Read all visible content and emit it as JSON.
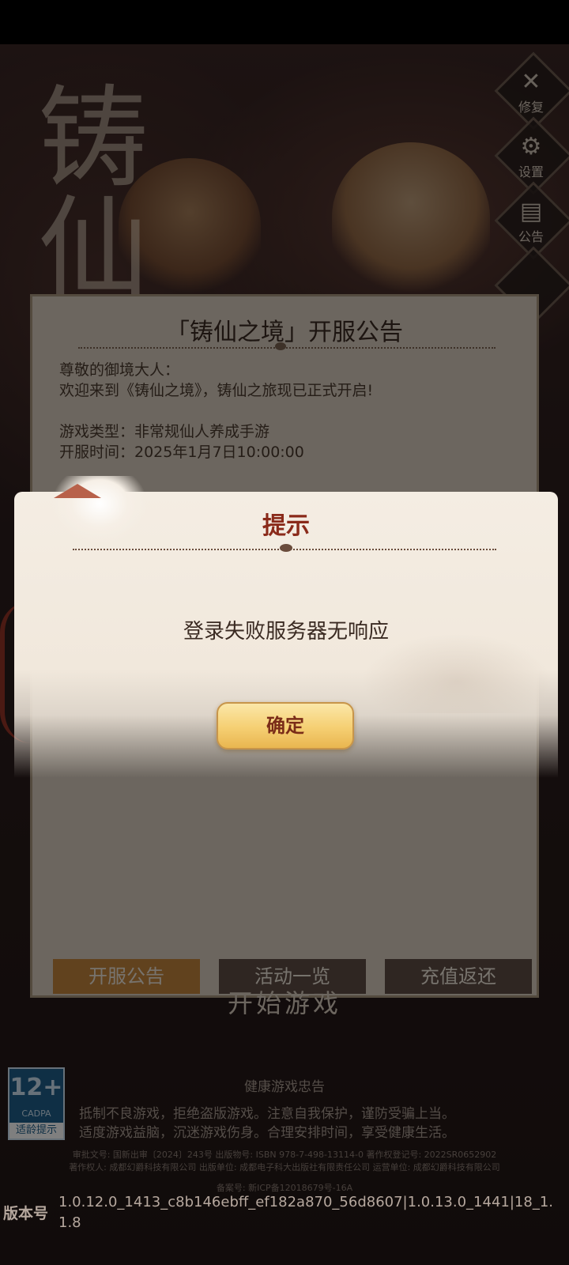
{
  "background": {
    "logo_text": "铸仙"
  },
  "side_menu": {
    "items": [
      {
        "label": "修复",
        "icon": "wrench-icon",
        "glyph": "✕"
      },
      {
        "label": "设置",
        "icon": "gear-icon",
        "glyph": "⚙"
      },
      {
        "label": "公告",
        "icon": "notice-board-icon",
        "glyph": "▤"
      }
    ]
  },
  "notice": {
    "title": "「铸仙之境」开服公告",
    "lines": [
      "尊敬的御境大人：",
      "欢迎来到《铸仙之境》，铸仙之旅现已正式开启!",
      "游戏类型：非常规仙人养成手游",
      "开服时间：2025年1月7日10:00:00"
    ],
    "tabs": [
      "开服公告",
      "活动一览",
      "充值返还"
    ],
    "active_tab": 0
  },
  "start_game_label": "开始游戏",
  "dialog": {
    "title": "提示",
    "message": "登录失败服务器无响应",
    "confirm_label": "确定"
  },
  "footer": {
    "age_rating": {
      "number": "12+",
      "org": "CADPA",
      "label": "适龄提示"
    },
    "health_title": "健康游戏忠告",
    "health_lines": [
      "抵制不良游戏，拒绝盗版游戏。注意自我保护，谨防受骗上当。",
      "适度游戏益脑，沉迷游戏伤身。合理安排时间，享受健康生活。"
    ],
    "legal_lines": [
      "审批文号: 国新出审〔2024〕243号 出版物号: ISBN 978-7-498-13114-0 著作权登记号: 2022SR0652902",
      "著作权人: 成都幻爵科技有限公司 出版单位: 成都电子科大出版社有限责任公司 运营单位: 成都幻爵科技有限公司",
      "备案号: 新ICP备12018679号-16A"
    ],
    "version_label": "版本号",
    "version_value": "1.0.12.0_1413_c8b146ebff_ef182a870_56d8607|1.0.13.0_1441|18_1.1.8"
  },
  "colors": {
    "dialog_title": "#8a2a1a",
    "confirm_button": "#f5cf72",
    "active_tab": "#c2843d"
  }
}
